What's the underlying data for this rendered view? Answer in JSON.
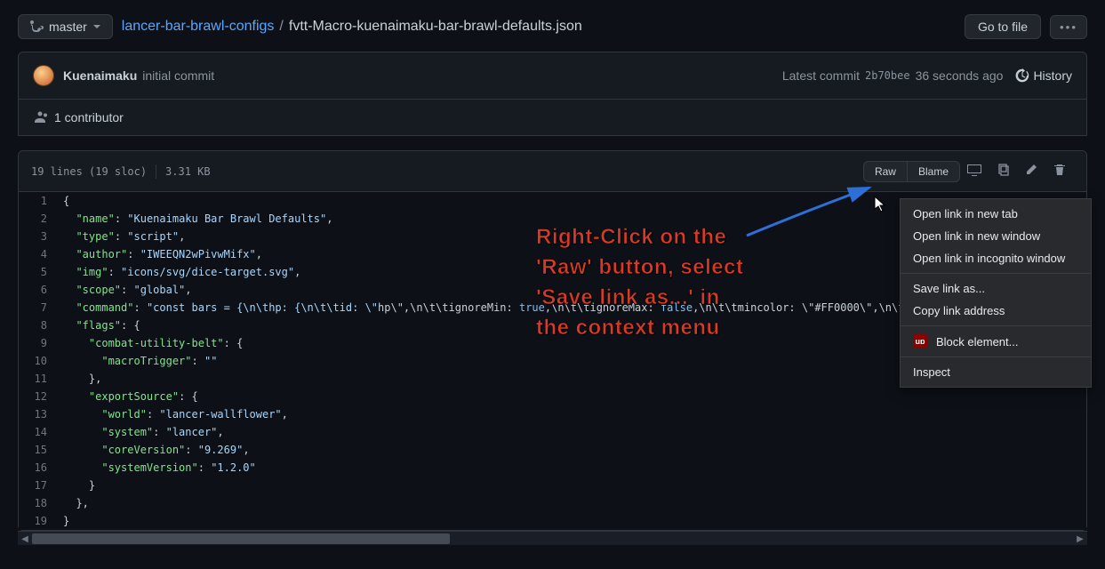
{
  "branch": {
    "label": "master"
  },
  "breadcrumb": {
    "repo": "lancer-bar-brawl-configs",
    "sep": "/",
    "file": "fvtt-Macro-kuenaimaku-bar-brawl-defaults.json"
  },
  "goToFile": "Go to file",
  "commit": {
    "author": "Kuenaimaku",
    "message": "initial commit",
    "latest": "Latest commit",
    "sha": "2b70bee",
    "when": "36 seconds ago",
    "history": "History"
  },
  "contributors": "1 contributor",
  "fileStats": {
    "lines": "19 lines (19 sloc)",
    "size": "3.31 KB"
  },
  "actions": {
    "raw": "Raw",
    "blame": "Blame"
  },
  "code": {
    "lines": [
      {
        "n": 1,
        "t": "{"
      },
      {
        "n": 2,
        "t": "  \"name\": \"Kuenaimaku Bar Brawl Defaults\","
      },
      {
        "n": 3,
        "t": "  \"type\": \"script\","
      },
      {
        "n": 4,
        "t": "  \"author\": \"IWEEQN2wPivwMifx\","
      },
      {
        "n": 5,
        "t": "  \"img\": \"icons/svg/dice-target.svg\","
      },
      {
        "n": 6,
        "t": "  \"scope\": \"global\","
      },
      {
        "n": 7,
        "t": "  \"command\": \"const bars = {\\n\\thp: {\\n\\t\\tid: \\\"hp\\\",\\n\\t\\tignoreMin: true,\\n\\t\\tignoreMax: false,\\n\\t\\tmincolor: \\\"#FF0000\\\",\\n\\t\\tmaxcolo"
      },
      {
        "n": 8,
        "t": "  \"flags\": {"
      },
      {
        "n": 9,
        "t": "    \"combat-utility-belt\": {"
      },
      {
        "n": 10,
        "t": "      \"macroTrigger\": \"\""
      },
      {
        "n": 11,
        "t": "    },"
      },
      {
        "n": 12,
        "t": "    \"exportSource\": {"
      },
      {
        "n": 13,
        "t": "      \"world\": \"lancer-wallflower\","
      },
      {
        "n": 14,
        "t": "      \"system\": \"lancer\","
      },
      {
        "n": 15,
        "t": "      \"coreVersion\": \"9.269\","
      },
      {
        "n": 16,
        "t": "      \"systemVersion\": \"1.2.0\""
      },
      {
        "n": 17,
        "t": "    }"
      },
      {
        "n": 18,
        "t": "  },"
      },
      {
        "n": 19,
        "t": "}"
      }
    ]
  },
  "annotation": {
    "l1": "Right-Click on the",
    "l2": "'Raw' button, select",
    "l3": "'Save link as...' in",
    "l4": "the context menu"
  },
  "contextMenu": {
    "i1": "Open link in new tab",
    "i2": "Open link in new window",
    "i3": "Open link in incognito window",
    "i4": "Save link as...",
    "i5": "Copy link address",
    "i6": "Block element...",
    "i7": "Inspect"
  }
}
